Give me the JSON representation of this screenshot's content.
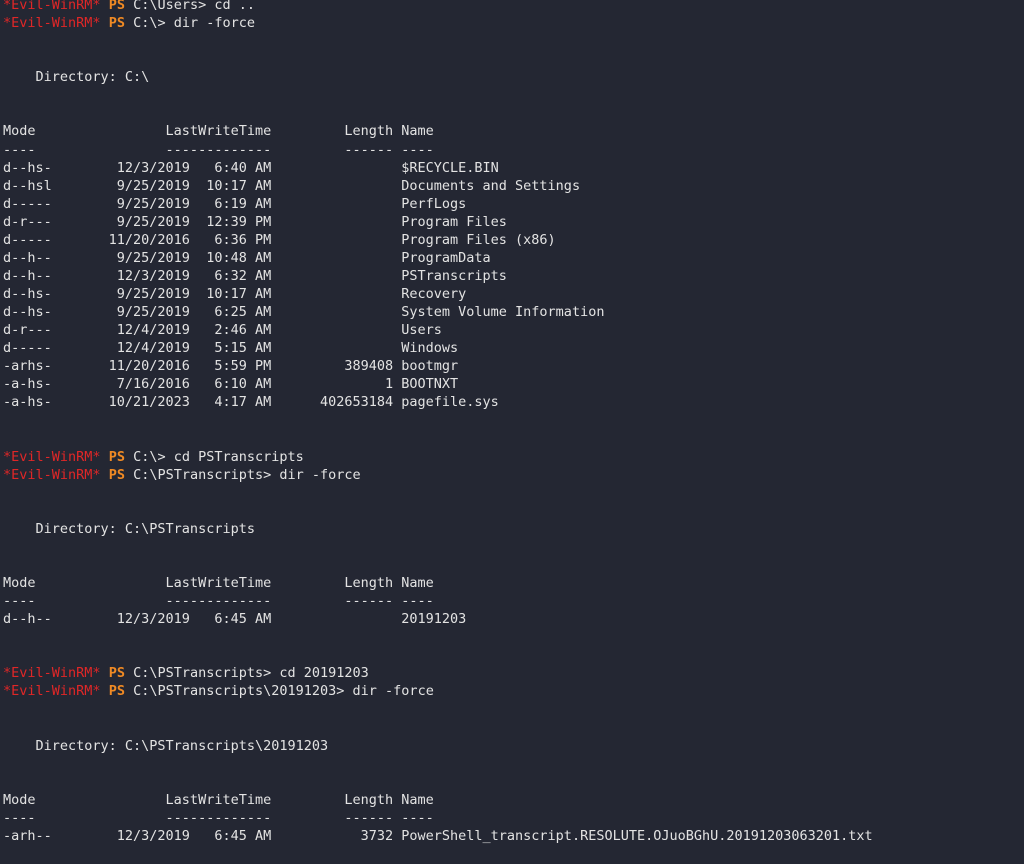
{
  "theme": {
    "background": "#242733",
    "foreground": "#e3e3e3",
    "prompt_name_color": "#e02727",
    "prompt_ps_color": "#f08a24"
  },
  "lines": [
    {
      "type": "prompt",
      "name": "*Evil-WinRM*",
      "ps": "PS",
      "text": "C:\\Users> cd ..",
      "clipped": true
    },
    {
      "type": "prompt",
      "name": "*Evil-WinRM*",
      "ps": "PS",
      "text": "C:\\> dir -force"
    },
    {
      "type": "text",
      "text": ""
    },
    {
      "type": "text",
      "text": ""
    },
    {
      "type": "text",
      "text": "    Directory: C:\\"
    },
    {
      "type": "text",
      "text": ""
    },
    {
      "type": "text",
      "text": ""
    },
    {
      "type": "text",
      "text": "Mode                LastWriteTime         Length Name"
    },
    {
      "type": "text",
      "text": "----                -------------         ------ ----"
    },
    {
      "type": "text",
      "text": "d--hs-        12/3/2019   6:40 AM                $RECYCLE.BIN"
    },
    {
      "type": "text",
      "text": "d--hsl        9/25/2019  10:17 AM                Documents and Settings"
    },
    {
      "type": "text",
      "text": "d-----        9/25/2019   6:19 AM                PerfLogs"
    },
    {
      "type": "text",
      "text": "d-r---        9/25/2019  12:39 PM                Program Files"
    },
    {
      "type": "text",
      "text": "d-----       11/20/2016   6:36 PM                Program Files (x86)"
    },
    {
      "type": "text",
      "text": "d--h--        9/25/2019  10:48 AM                ProgramData"
    },
    {
      "type": "text",
      "text": "d--h--        12/3/2019   6:32 AM                PSTranscripts"
    },
    {
      "type": "text",
      "text": "d--hs-        9/25/2019  10:17 AM                Recovery"
    },
    {
      "type": "text",
      "text": "d--hs-        9/25/2019   6:25 AM                System Volume Information"
    },
    {
      "type": "text",
      "text": "d-r---        12/4/2019   2:46 AM                Users"
    },
    {
      "type": "text",
      "text": "d-----        12/4/2019   5:15 AM                Windows"
    },
    {
      "type": "text",
      "text": "-arhs-       11/20/2016   5:59 PM         389408 bootmgr"
    },
    {
      "type": "text",
      "text": "-a-hs-        7/16/2016   6:10 AM              1 BOOTNXT"
    },
    {
      "type": "text",
      "text": "-a-hs-       10/21/2023   4:17 AM      402653184 pagefile.sys"
    },
    {
      "type": "text",
      "text": ""
    },
    {
      "type": "text",
      "text": ""
    },
    {
      "type": "prompt",
      "name": "*Evil-WinRM*",
      "ps": "PS",
      "text": "C:\\> cd PSTranscripts"
    },
    {
      "type": "prompt",
      "name": "*Evil-WinRM*",
      "ps": "PS",
      "text": "C:\\PSTranscripts> dir -force"
    },
    {
      "type": "text",
      "text": ""
    },
    {
      "type": "text",
      "text": ""
    },
    {
      "type": "text",
      "text": "    Directory: C:\\PSTranscripts"
    },
    {
      "type": "text",
      "text": ""
    },
    {
      "type": "text",
      "text": ""
    },
    {
      "type": "text",
      "text": "Mode                LastWriteTime         Length Name"
    },
    {
      "type": "text",
      "text": "----                -------------         ------ ----"
    },
    {
      "type": "text",
      "text": "d--h--        12/3/2019   6:45 AM                20191203"
    },
    {
      "type": "text",
      "text": ""
    },
    {
      "type": "text",
      "text": ""
    },
    {
      "type": "prompt",
      "name": "*Evil-WinRM*",
      "ps": "PS",
      "text": "C:\\PSTranscripts> cd 20191203"
    },
    {
      "type": "prompt",
      "name": "*Evil-WinRM*",
      "ps": "PS",
      "text": "C:\\PSTranscripts\\20191203> dir -force"
    },
    {
      "type": "text",
      "text": ""
    },
    {
      "type": "text",
      "text": ""
    },
    {
      "type": "text",
      "text": "    Directory: C:\\PSTranscripts\\20191203"
    },
    {
      "type": "text",
      "text": ""
    },
    {
      "type": "text",
      "text": ""
    },
    {
      "type": "text",
      "text": "Mode                LastWriteTime         Length Name"
    },
    {
      "type": "text",
      "text": "----                -------------         ------ ----"
    },
    {
      "type": "text",
      "text": "-arh--        12/3/2019   6:45 AM           3732 PowerShell_transcript.RESOLUTE.OJuoBGhU.20191203063201.txt"
    }
  ]
}
